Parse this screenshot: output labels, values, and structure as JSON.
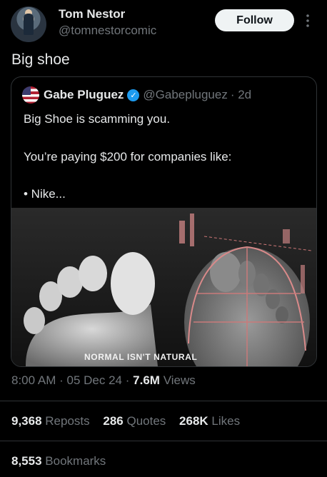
{
  "author": {
    "name": "Tom Nestor",
    "handle": "@tomnestorcomic",
    "follow_label": "Follow",
    "more_label": "⋮"
  },
  "tweet": {
    "text": "Big shoe"
  },
  "quote": {
    "name": "Gabe Pluguez",
    "handle": "@Gabepluguez",
    "time": "· 2d",
    "line1": "Big Shoe is scamming you.",
    "line2": "You’re paying $200 for companies like:",
    "line3": "• Nike...",
    "image_caption": "NORMAL ISN'T NATURAL"
  },
  "meta": {
    "time": "8:00 AM",
    "sep1": "·",
    "date": "05 Dec 24",
    "sep2": "·",
    "views_count": "7.6M",
    "views_label": "Views"
  },
  "stats": {
    "reposts_count": "9,368",
    "reposts_label": "Reposts",
    "quotes_count": "286",
    "quotes_label": "Quotes",
    "likes_count": "268K",
    "likes_label": "Likes",
    "bookmarks_count": "8,553",
    "bookmarks_label": "Bookmarks"
  },
  "colors": {
    "background": "#000000",
    "text": "#e7e9ea",
    "secondary": "#71767b",
    "verified": "#1d9bf0",
    "follow_bg": "#eff3f4"
  }
}
